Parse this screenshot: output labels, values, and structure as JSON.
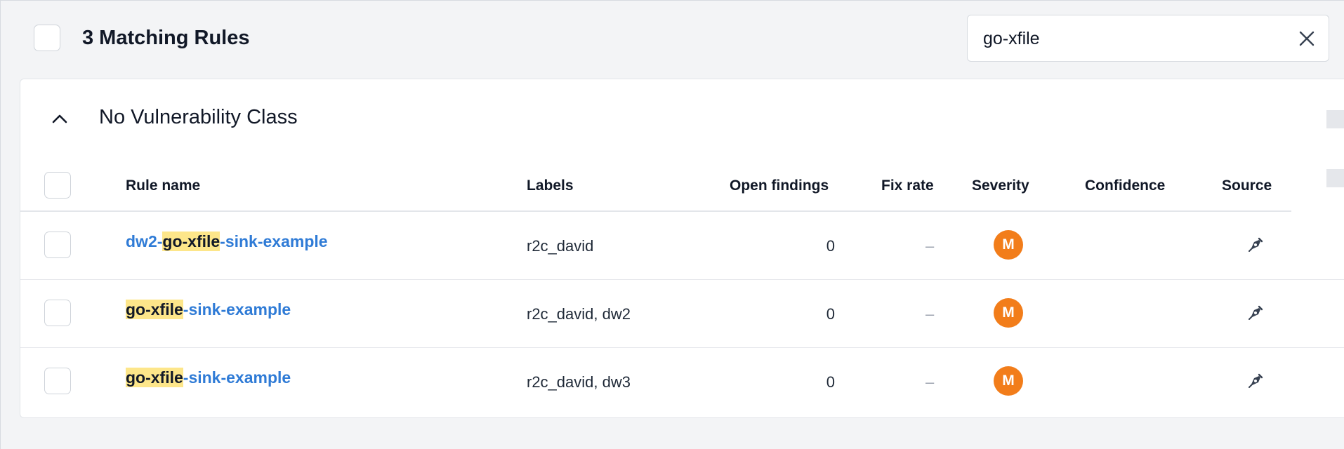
{
  "toolbar": {
    "title": "3 Matching Rules",
    "search_value": "go-xfile",
    "search_clear_icon": "close-icon"
  },
  "group": {
    "title": "No Vulnerability Class",
    "toggle_icon": "chevron-up-icon"
  },
  "table": {
    "columns": [
      "Rule name",
      "Labels",
      "Open findings",
      "Fix rate",
      "Severity",
      "Confidence",
      "Source"
    ],
    "rows": [
      {
        "name_prefix": "dw2-",
        "name_match": "go-xfile",
        "name_suffix": "-sink-example",
        "labels": "r2c_david",
        "open_findings": "0",
        "fix_rate": "–",
        "severity": "M",
        "confidence": "",
        "source_icon": "pen-nib-icon"
      },
      {
        "name_prefix": "",
        "name_match": "go-xfile",
        "name_suffix": "-sink-example",
        "labels": "r2c_david, dw2",
        "open_findings": "0",
        "fix_rate": "–",
        "severity": "M",
        "confidence": "",
        "source_icon": "pen-nib-icon"
      },
      {
        "name_prefix": "",
        "name_match": "go-xfile",
        "name_suffix": "-sink-example",
        "labels": "r2c_david, dw3",
        "open_findings": "0",
        "fix_rate": "–",
        "severity": "M",
        "confidence": "",
        "source_icon": "pen-nib-icon"
      }
    ]
  },
  "colors": {
    "link": "#2f7bd6",
    "highlight": "#fde68a",
    "severity_medium": "#f27d1a"
  }
}
